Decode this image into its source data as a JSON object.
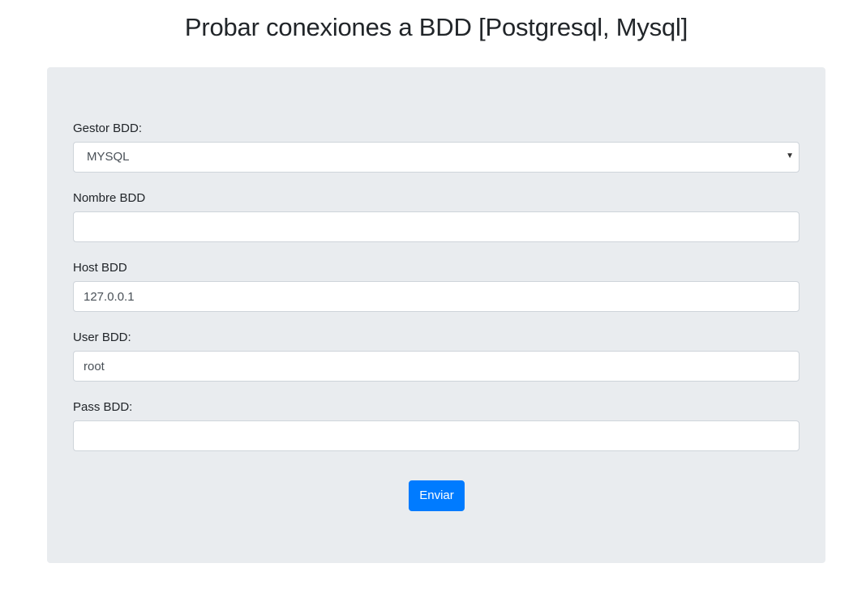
{
  "page": {
    "title": "Probar conexiones a BDD [Postgresql, Mysql]"
  },
  "form": {
    "gestor": {
      "label": "Gestor BDD:",
      "selected": "MYSQL"
    },
    "nombre": {
      "label": "Nombre BDD",
      "value": ""
    },
    "host": {
      "label": "Host BDD",
      "value": "127.0.0.1"
    },
    "user": {
      "label": "User BDD:",
      "value": "root"
    },
    "pass": {
      "label": "Pass BDD:",
      "value": ""
    },
    "submit_label": "Enviar"
  },
  "icons": {
    "select_caret": "chevron-down-icon"
  },
  "colors": {
    "panel_bg": "#e9ecef",
    "button_primary": "#007bff",
    "button_text": "#ffffff"
  }
}
